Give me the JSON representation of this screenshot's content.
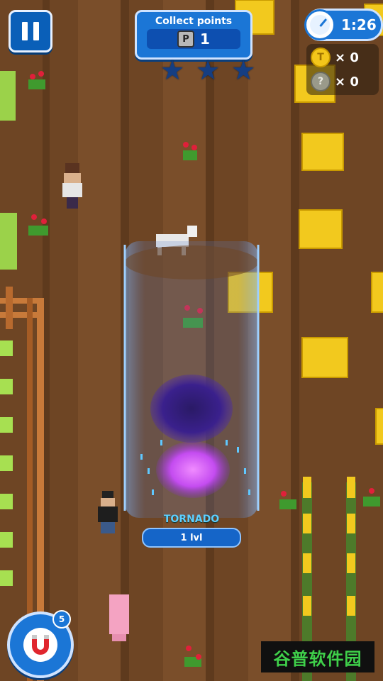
{
  "hud": {
    "pause_icon": "pause-icon",
    "collect_title": "Collect points",
    "collect_icon_letter": "P",
    "collect_value": "1",
    "stars_total": 3,
    "stars_earned": 0,
    "star_glyph": "★",
    "timer_icon": "stopwatch-icon",
    "timer": "1:26",
    "coins_icon_glyph": "T",
    "coins": "× 0",
    "mystery_icon_glyph": "?",
    "mystery": "× 0"
  },
  "power": {
    "name": "TORNADO",
    "level": "1 lvl"
  },
  "magnet": {
    "icon": "magnet-icon",
    "count": "5"
  },
  "watermark": "谷普软件园",
  "colors": {
    "ui_blue": "#1b76d6",
    "soil": "#6b4423",
    "hay": "#f2c91e",
    "tornado_purple": "#b44cff"
  }
}
